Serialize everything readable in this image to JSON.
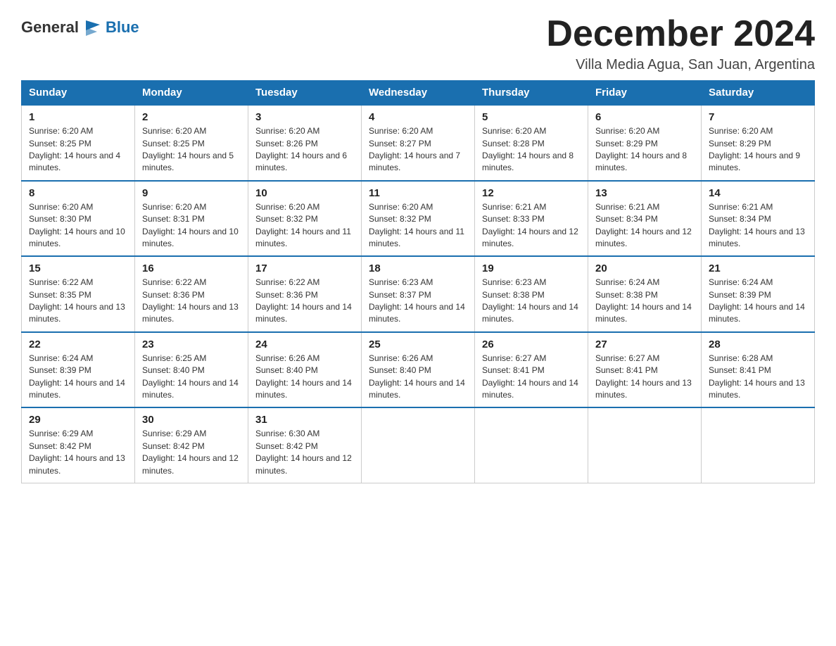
{
  "header": {
    "logo_general": "General",
    "logo_blue": "Blue",
    "month_title": "December 2024",
    "location": "Villa Media Agua, San Juan, Argentina"
  },
  "days_of_week": [
    "Sunday",
    "Monday",
    "Tuesday",
    "Wednesday",
    "Thursday",
    "Friday",
    "Saturday"
  ],
  "weeks": [
    [
      {
        "day": "1",
        "sunrise": "6:20 AM",
        "sunset": "8:25 PM",
        "daylight": "14 hours and 4 minutes."
      },
      {
        "day": "2",
        "sunrise": "6:20 AM",
        "sunset": "8:25 PM",
        "daylight": "14 hours and 5 minutes."
      },
      {
        "day": "3",
        "sunrise": "6:20 AM",
        "sunset": "8:26 PM",
        "daylight": "14 hours and 6 minutes."
      },
      {
        "day": "4",
        "sunrise": "6:20 AM",
        "sunset": "8:27 PM",
        "daylight": "14 hours and 7 minutes."
      },
      {
        "day": "5",
        "sunrise": "6:20 AM",
        "sunset": "8:28 PM",
        "daylight": "14 hours and 8 minutes."
      },
      {
        "day": "6",
        "sunrise": "6:20 AM",
        "sunset": "8:29 PM",
        "daylight": "14 hours and 8 minutes."
      },
      {
        "day": "7",
        "sunrise": "6:20 AM",
        "sunset": "8:29 PM",
        "daylight": "14 hours and 9 minutes."
      }
    ],
    [
      {
        "day": "8",
        "sunrise": "6:20 AM",
        "sunset": "8:30 PM",
        "daylight": "14 hours and 10 minutes."
      },
      {
        "day": "9",
        "sunrise": "6:20 AM",
        "sunset": "8:31 PM",
        "daylight": "14 hours and 10 minutes."
      },
      {
        "day": "10",
        "sunrise": "6:20 AM",
        "sunset": "8:32 PM",
        "daylight": "14 hours and 11 minutes."
      },
      {
        "day": "11",
        "sunrise": "6:20 AM",
        "sunset": "8:32 PM",
        "daylight": "14 hours and 11 minutes."
      },
      {
        "day": "12",
        "sunrise": "6:21 AM",
        "sunset": "8:33 PM",
        "daylight": "14 hours and 12 minutes."
      },
      {
        "day": "13",
        "sunrise": "6:21 AM",
        "sunset": "8:34 PM",
        "daylight": "14 hours and 12 minutes."
      },
      {
        "day": "14",
        "sunrise": "6:21 AM",
        "sunset": "8:34 PM",
        "daylight": "14 hours and 13 minutes."
      }
    ],
    [
      {
        "day": "15",
        "sunrise": "6:22 AM",
        "sunset": "8:35 PM",
        "daylight": "14 hours and 13 minutes."
      },
      {
        "day": "16",
        "sunrise": "6:22 AM",
        "sunset": "8:36 PM",
        "daylight": "14 hours and 13 minutes."
      },
      {
        "day": "17",
        "sunrise": "6:22 AM",
        "sunset": "8:36 PM",
        "daylight": "14 hours and 14 minutes."
      },
      {
        "day": "18",
        "sunrise": "6:23 AM",
        "sunset": "8:37 PM",
        "daylight": "14 hours and 14 minutes."
      },
      {
        "day": "19",
        "sunrise": "6:23 AM",
        "sunset": "8:38 PM",
        "daylight": "14 hours and 14 minutes."
      },
      {
        "day": "20",
        "sunrise": "6:24 AM",
        "sunset": "8:38 PM",
        "daylight": "14 hours and 14 minutes."
      },
      {
        "day": "21",
        "sunrise": "6:24 AM",
        "sunset": "8:39 PM",
        "daylight": "14 hours and 14 minutes."
      }
    ],
    [
      {
        "day": "22",
        "sunrise": "6:24 AM",
        "sunset": "8:39 PM",
        "daylight": "14 hours and 14 minutes."
      },
      {
        "day": "23",
        "sunrise": "6:25 AM",
        "sunset": "8:40 PM",
        "daylight": "14 hours and 14 minutes."
      },
      {
        "day": "24",
        "sunrise": "6:26 AM",
        "sunset": "8:40 PM",
        "daylight": "14 hours and 14 minutes."
      },
      {
        "day": "25",
        "sunrise": "6:26 AM",
        "sunset": "8:40 PM",
        "daylight": "14 hours and 14 minutes."
      },
      {
        "day": "26",
        "sunrise": "6:27 AM",
        "sunset": "8:41 PM",
        "daylight": "14 hours and 14 minutes."
      },
      {
        "day": "27",
        "sunrise": "6:27 AM",
        "sunset": "8:41 PM",
        "daylight": "14 hours and 13 minutes."
      },
      {
        "day": "28",
        "sunrise": "6:28 AM",
        "sunset": "8:41 PM",
        "daylight": "14 hours and 13 minutes."
      }
    ],
    [
      {
        "day": "29",
        "sunrise": "6:29 AM",
        "sunset": "8:42 PM",
        "daylight": "14 hours and 13 minutes."
      },
      {
        "day": "30",
        "sunrise": "6:29 AM",
        "sunset": "8:42 PM",
        "daylight": "14 hours and 12 minutes."
      },
      {
        "day": "31",
        "sunrise": "6:30 AM",
        "sunset": "8:42 PM",
        "daylight": "14 hours and 12 minutes."
      },
      null,
      null,
      null,
      null
    ]
  ]
}
